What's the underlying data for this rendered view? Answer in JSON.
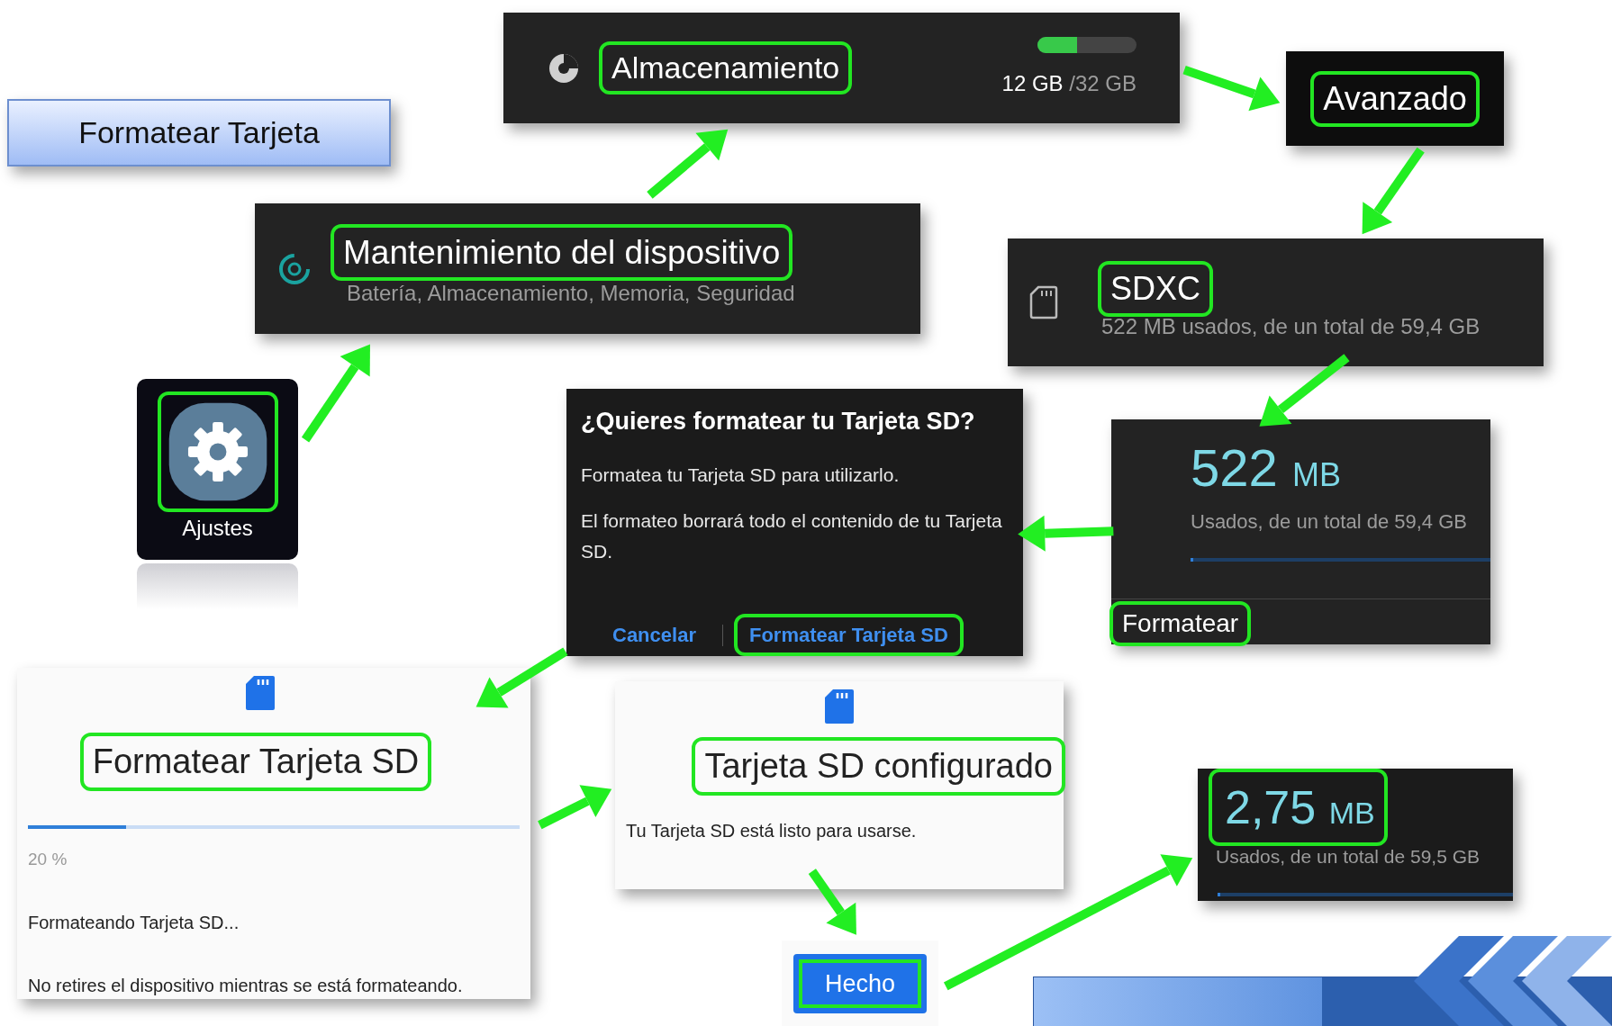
{
  "title": "Formatear Tarjeta",
  "settings_app": {
    "label": "Ajustes",
    "highlighted": true
  },
  "maintenance_item": {
    "label": "Mantenimiento del dispositivo",
    "subtitle": "Batería, Almacenamiento, Memoria, Seguridad",
    "highlighted": true
  },
  "storage_item": {
    "label": "Almacenamiento",
    "level": 0.4,
    "used": "12 GB",
    "total": "/32 GB",
    "highlighted": true
  },
  "advanced_item": {
    "label": "Avanzado",
    "highlighted": true
  },
  "sd_item": {
    "label": "SDXC",
    "subtitle": "522 MB usados, de un total de 59,4 GB",
    "highlighted": true
  },
  "sd_usage": {
    "amount": "522",
    "unit": "MB",
    "subtitle": "Usados, de un total de 59,4 GB",
    "level": 0.01,
    "action": "Formatear",
    "action_highlighted": true
  },
  "dialog": {
    "title": "¿Quieres formatear tu Tarjeta SD?",
    "messages": [
      "Formatea tu Tarjeta SD para utilizarlo.",
      "El formateo borrará todo el contenido de tu Tarjeta SD."
    ],
    "buttons": [
      {
        "label": "Cancelar",
        "highlighted": false
      },
      {
        "label": "Formatear Tarjeta SD",
        "highlighted": true
      }
    ]
  },
  "progress_screen": {
    "title": "Formatear Tarjeta SD",
    "title_highlighted": true,
    "level": 0.2,
    "percent": "20 %",
    "status": "Formateando Tarjeta SD...",
    "note": "No retires el dispositivo mientras se está formateando."
  },
  "done_screen": {
    "title": "Tarjeta SD configurado",
    "title_highlighted": true,
    "message": "Tu Tarjeta SD está listo para usarse."
  },
  "done_button": {
    "label": "Hecho",
    "highlighted": true
  },
  "result_usage": {
    "amount": "2,75",
    "unit": "MB",
    "subtitle": "Usados, de un total de 59,5 GB",
    "level": 0.01,
    "highlighted": true
  }
}
